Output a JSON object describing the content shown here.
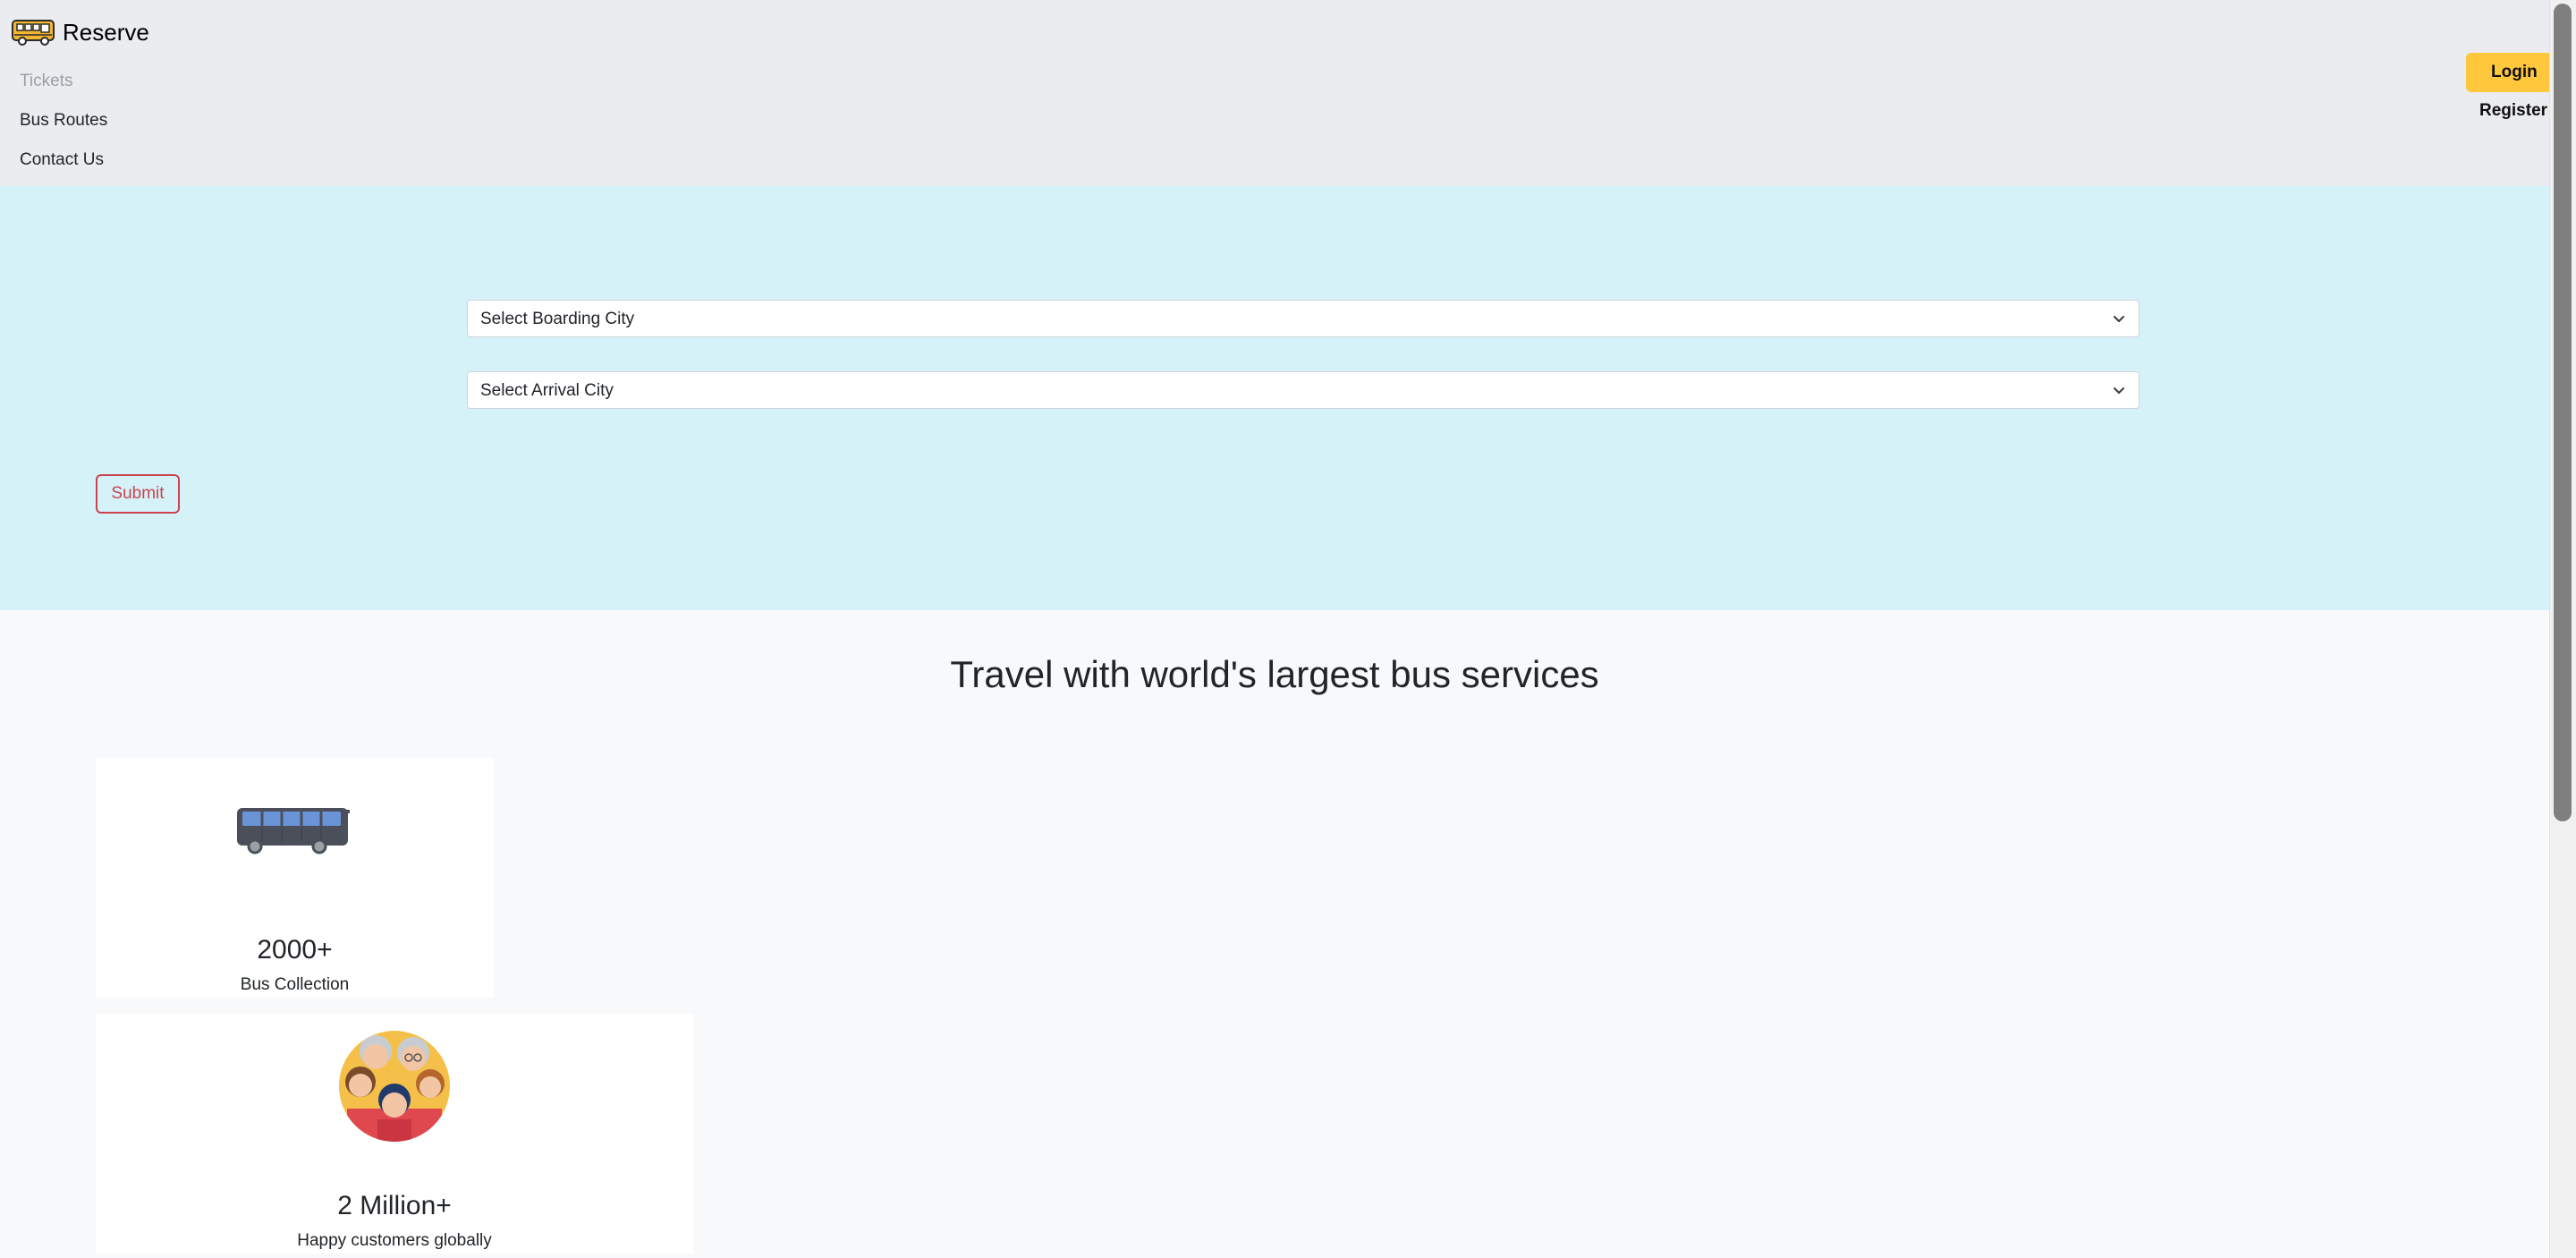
{
  "brand": {
    "name": "Reserve",
    "icon": "bus-icon"
  },
  "nav": {
    "items": [
      {
        "label": "Tickets",
        "disabled": true
      },
      {
        "label": "Bus Routes",
        "disabled": false
      },
      {
        "label": "Contact Us",
        "disabled": false
      }
    ],
    "login_label": "Login",
    "register_label": "Register"
  },
  "search": {
    "boarding_placeholder": "Select Boarding City",
    "arrival_placeholder": "Select Arrival City",
    "submit_label": "Submit"
  },
  "stats": {
    "title": "Travel with world's largest bus services",
    "cards": [
      {
        "number": "2000+",
        "label": "Bus Collection",
        "icon": "bus-icon"
      },
      {
        "number": "2 Million+",
        "label": "Happy customers globally",
        "icon": "customers-icon"
      }
    ]
  },
  "colors": {
    "navbar_bg": "#ebecf0",
    "search_bg": "#d6f2f9",
    "login_bg": "#ffc73b",
    "submit_accent": "#c9444f",
    "page_bg": "#f8f9fa"
  }
}
